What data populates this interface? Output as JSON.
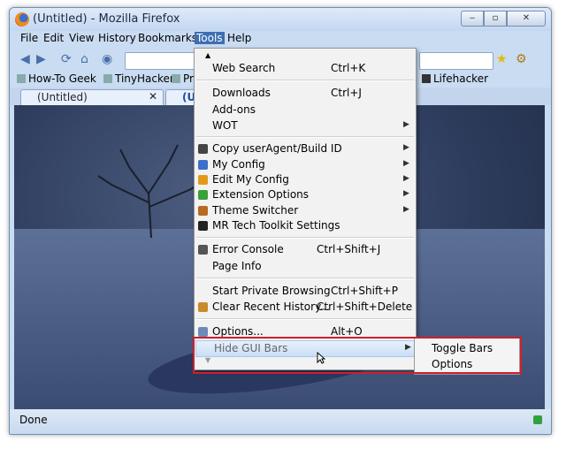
{
  "window": {
    "title": "(Untitled) - Mozilla Firefox",
    "controls": {
      "minimize": "‒",
      "maximize": "▫",
      "close": "✕"
    }
  },
  "menubar": {
    "file": "File",
    "edit": "Edit",
    "view": "View",
    "history": "History",
    "bookmarks": "Bookmarks",
    "tools": "Tools",
    "help": "Help"
  },
  "bookmarks": {
    "b1": "How-To Geek",
    "b2": "TinyHacker",
    "b3": "Pr",
    "b4": "Lifehacker"
  },
  "tabs": {
    "tab1": "(Untitled)",
    "tab2": "(U"
  },
  "tools_menu": {
    "web_search": "Web Search",
    "web_search_sc": "Ctrl+K",
    "downloads": "Downloads",
    "downloads_sc": "Ctrl+J",
    "addons": "Add-ons",
    "wot": "WOT",
    "copy_ua": "Copy userAgent/Build ID",
    "my_config": "My Config",
    "edit_my_config": "Edit My Config",
    "extension_options": "Extension Options",
    "theme_switcher": "Theme Switcher",
    "mr_tech": "MR Tech Toolkit Settings",
    "error_console": "Error Console",
    "error_console_sc": "Ctrl+Shift+J",
    "page_info": "Page Info",
    "private_browsing": "Start Private Browsing",
    "private_browsing_sc": "Ctrl+Shift+P",
    "clear_history": "Clear Recent History...",
    "clear_history_sc": "Ctrl+Shift+Delete",
    "options": "Options...",
    "options_sc": "Alt+O",
    "hide_gui_bars": "Hide GUI Bars"
  },
  "submenu": {
    "toggle_bars": "Toggle Bars",
    "options": "Options"
  },
  "status": {
    "text": "Done"
  }
}
